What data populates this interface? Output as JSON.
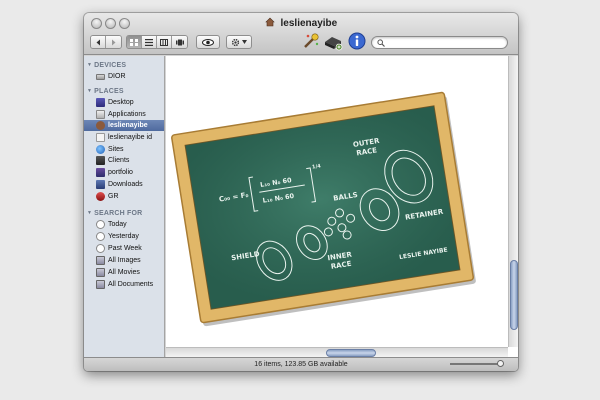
{
  "window": {
    "title": "leslienayibe",
    "status_text": "16 items, 123.85 GB available"
  },
  "sidebar": {
    "sections": [
      {
        "label": "DEVICES",
        "items": [
          {
            "label": "DIOR",
            "icon": "drive-icon"
          }
        ]
      },
      {
        "label": "PLACES",
        "items": [
          {
            "label": "Desktop",
            "icon": "desktop-icon"
          },
          {
            "label": "Applications",
            "icon": "applications-icon"
          },
          {
            "label": "leslienayibe",
            "icon": "home-icon",
            "selected": true
          },
          {
            "label": "leslienayibe id",
            "icon": "document-icon"
          },
          {
            "label": "Sites",
            "icon": "sites-icon"
          },
          {
            "label": "Clients",
            "icon": "clients-icon"
          },
          {
            "label": "portfolio",
            "icon": "portfolio-icon"
          },
          {
            "label": "Downloads",
            "icon": "downloads-icon"
          },
          {
            "label": "GR",
            "icon": "gr-icon"
          }
        ]
      },
      {
        "label": "SEARCH FOR",
        "items": [
          {
            "label": "Today",
            "icon": "clock-icon"
          },
          {
            "label": "Yesterday",
            "icon": "clock-icon"
          },
          {
            "label": "Past Week",
            "icon": "clock-icon"
          },
          {
            "label": "All Images",
            "icon": "smart-folder-icon"
          },
          {
            "label": "All Movies",
            "icon": "smart-folder-icon"
          },
          {
            "label": "All Documents",
            "icon": "smart-folder-icon"
          }
        ]
      }
    ]
  },
  "chalkboard": {
    "formula_left": "C₀₀ = F₀",
    "formula_top": "L₁₀ N₀ 60",
    "formula_bottom": "L₁₀ N₀ 60",
    "formula_exp": "1/4",
    "label_outer": "OUTER",
    "label_race": "RACE",
    "label_balls": "BALLS",
    "label_retainer": "RETAINER",
    "label_shield": "SHIELD",
    "label_inner": "INNER",
    "label_inner_race": "RACE",
    "signature": "LESLIE NAYIBE"
  },
  "colors": {
    "selection": "#5a74a7",
    "board": "#2f6a58",
    "frame": "#e0b866"
  }
}
